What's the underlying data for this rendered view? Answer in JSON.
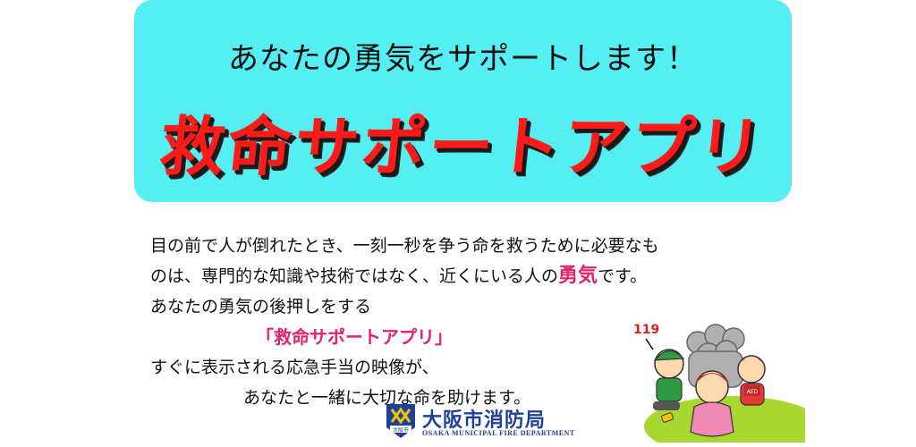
{
  "banner": {
    "tagline": "あなたの勇気をサポートします！",
    "title": "救命サポートアプリ"
  },
  "body": {
    "line1": "目の前で人が倒れたとき、一刻一秒を争う命を救うために必要なも",
    "line2_pre": "のは、専門的な知識や技術ではなく、近くにいる人の",
    "line2_emph": "勇気",
    "line2_post": "です。",
    "line3": "あなたの勇気の後押しをする",
    "line4": "「救命サポートアプリ」",
    "line5": "すぐに表示される応急手当の映像が、",
    "line6": "あなたと一緒に大切な命を助けます。"
  },
  "logo": {
    "name": "大阪市消防局",
    "english": "OSAKA MUNICIPAL FIRE DEPARTMENT",
    "emblem_text": "大阪市"
  },
  "illustration": {
    "number": "119",
    "aed_label": "AED"
  },
  "colors": {
    "banner": "#55eef2",
    "title_red": "#ff1a1a",
    "accent_pink": "#e6226b",
    "logo_blue": "#1e3f9b"
  }
}
